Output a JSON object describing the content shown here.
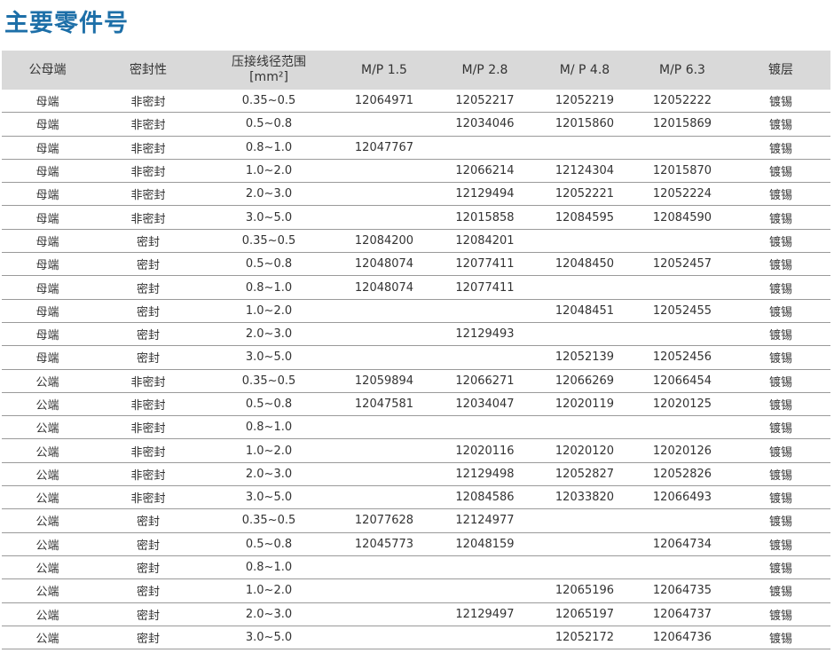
{
  "title": "主要零件号",
  "table": {
    "headers": [
      "公母端",
      "密封性",
      "压接线径范围\n[mm²]",
      "M/P 1.5",
      "M/P 2.8",
      "M/ P 4.8",
      "M/P 6.3",
      "镀层"
    ],
    "rows": [
      [
        "母端",
        "非密封",
        "0.35~0.5",
        "12064971",
        "12052217",
        "12052219",
        "12052222",
        "镀锡"
      ],
      [
        "母端",
        "非密封",
        "0.5~0.8",
        "",
        "12034046",
        "12015860",
        "12015869",
        "镀锡"
      ],
      [
        "母端",
        "非密封",
        "0.8~1.0",
        "12047767",
        "",
        "",
        "",
        "镀锡"
      ],
      [
        "母端",
        "非密封",
        "1.0~2.0",
        "",
        "12066214",
        "12124304",
        "12015870",
        "镀锡"
      ],
      [
        "母端",
        "非密封",
        "2.0~3.0",
        "",
        "12129494",
        "12052221",
        "12052224",
        "镀锡"
      ],
      [
        "母端",
        "非密封",
        "3.0~5.0",
        "",
        "12015858",
        "12084595",
        "12084590",
        "镀锡"
      ],
      [
        "母端",
        "密封",
        "0.35~0.5",
        "12084200",
        "12084201",
        "",
        "",
        "镀锡"
      ],
      [
        "母端",
        "密封",
        "0.5~0.8",
        "12048074",
        "12077411",
        "12048450",
        "12052457",
        "镀锡"
      ],
      [
        "母端",
        "密封",
        "0.8~1.0",
        "12048074",
        "12077411",
        "",
        "",
        "镀锡"
      ],
      [
        "母端",
        "密封",
        "1.0~2.0",
        "",
        "",
        "12048451",
        "12052455",
        "镀锡"
      ],
      [
        "母端",
        "密封",
        "2.0~3.0",
        "",
        "12129493",
        "",
        "",
        "镀锡"
      ],
      [
        "母端",
        "密封",
        "3.0~5.0",
        "",
        "",
        "12052139",
        "12052456",
        "镀锡"
      ],
      [
        "公端",
        "非密封",
        "0.35~0.5",
        "12059894",
        "12066271",
        "12066269",
        "12066454",
        "镀锡"
      ],
      [
        "公端",
        "非密封",
        "0.5~0.8",
        "12047581",
        "12034047",
        "12020119",
        "12020125",
        "镀锡"
      ],
      [
        "公端",
        "非密封",
        "0.8~1.0",
        "",
        "",
        "",
        "",
        "镀锡"
      ],
      [
        "公端",
        "非密封",
        "1.0~2.0",
        "",
        "12020116",
        "12020120",
        "12020126",
        "镀锡"
      ],
      [
        "公端",
        "非密封",
        "2.0~3.0",
        "",
        "12129498",
        "12052827",
        "12052826",
        "镀锡"
      ],
      [
        "公端",
        "非密封",
        "3.0~5.0",
        "",
        "12084586",
        "12033820",
        "12066493",
        "镀锡"
      ],
      [
        "公端",
        "密封",
        "0.35~0.5",
        "12077628",
        "12124977",
        "",
        "",
        "镀锡"
      ],
      [
        "公端",
        "密封",
        "0.5~0.8",
        "12045773",
        "12048159",
        "",
        "12064734",
        "镀锡"
      ],
      [
        "公端",
        "密封",
        "0.8~1.0",
        "",
        "",
        "",
        "",
        "镀锡"
      ],
      [
        "公端",
        "密封",
        "1.0~2.0",
        "",
        "",
        "12065196",
        "12064735",
        "镀锡"
      ],
      [
        "公端",
        "密封",
        "2.0~3.0",
        "",
        "12129497",
        "12065197",
        "12064737",
        "镀锡"
      ],
      [
        "公端",
        "密封",
        "3.0~5.0",
        "",
        "",
        "12052172",
        "12064736",
        "镀锡"
      ]
    ]
  }
}
